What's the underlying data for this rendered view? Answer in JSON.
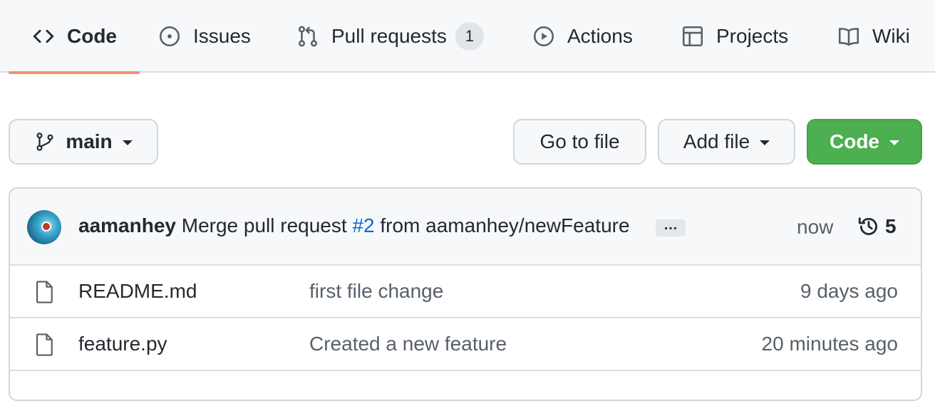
{
  "tabs": [
    {
      "label": "Code",
      "icon": "code-icon",
      "selected": true
    },
    {
      "label": "Issues",
      "icon": "issue-opened-icon"
    },
    {
      "label": "Pull requests",
      "icon": "git-pull-request-icon",
      "count": "1"
    },
    {
      "label": "Actions",
      "icon": "play-icon"
    },
    {
      "label": "Projects",
      "icon": "table-icon"
    },
    {
      "label": "Wiki",
      "icon": "book-icon"
    }
  ],
  "toolbar": {
    "branch": "main",
    "go_to_file": "Go to file",
    "add_file": "Add file",
    "code": "Code"
  },
  "commit": {
    "author": "aamanhey",
    "message_prefix": "Merge pull request",
    "pr_link": "#2",
    "message_suffix": "from aamanhey/newFeature",
    "ellipsis": "…",
    "time": "now",
    "commit_count": "5"
  },
  "files": [
    {
      "name": "README.md",
      "message": "first file change",
      "time": "9 days ago"
    },
    {
      "name": "feature.py",
      "message": "Created a new feature",
      "time": "20 minutes ago"
    }
  ],
  "colors": {
    "accent_underline": "#fd8c73",
    "code_button": "#4caf50",
    "link": "#0969da"
  }
}
